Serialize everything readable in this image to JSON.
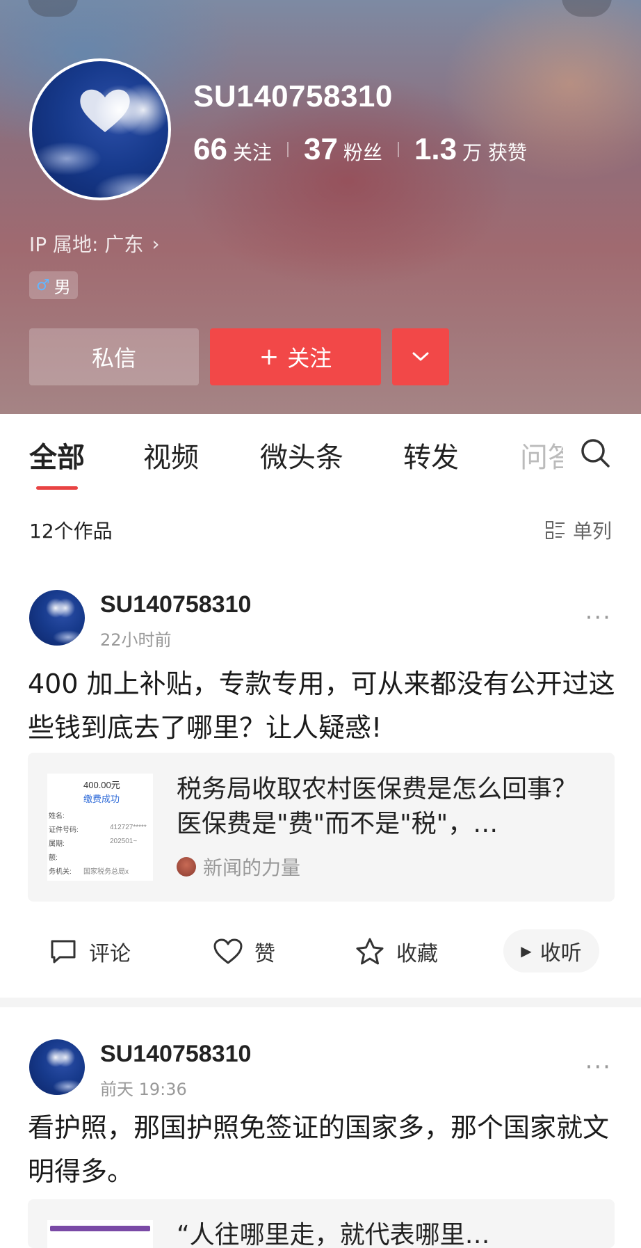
{
  "profile": {
    "username": "SU140758310",
    "following_count": "66",
    "following_label": "关注",
    "followers_count": "37",
    "followers_label": "粉丝",
    "likes_count": "1.3",
    "likes_unit_label": "万 获赞",
    "ip_location": "IP 属地: 广东",
    "gender": "男",
    "message_button": "私信",
    "follow_button": "关注"
  },
  "tabs": [
    "全部",
    "视频",
    "微头条",
    "转发",
    "问答"
  ],
  "works_count": "12个作品",
  "view_mode": "单列",
  "posts": [
    {
      "author": "SU140758310",
      "time": "22小时前",
      "text": "400 加上补贴，专款专用，可从来都没有公开过这些钱到底去了哪里？让人疑惑!",
      "card": {
        "title": "税务局收取农村医保费是怎么回事？医保费是\"费\"而不是\"税\"，…",
        "source": "新闻的力量",
        "thumb": {
          "amount": "400.00元",
          "status": "缴费成功",
          "rows": [
            {
              "label": "姓名:",
              "value": ""
            },
            {
              "label": "证件号码:",
              "value": "412727*****"
            },
            {
              "label": "属期:",
              "value": "202501~"
            },
            {
              "label": "额:",
              "value": ""
            },
            {
              "label": "务机关:",
              "value": "国家税务总局x"
            }
          ]
        }
      },
      "actions": {
        "comment": "评论",
        "like": "赞",
        "favorite": "收藏",
        "listen": "收听"
      }
    },
    {
      "author": "SU140758310",
      "time": "前天 19:36",
      "text": "看护照，那国护照免签证的国家多，那个国家就文明得多。",
      "card": {
        "title": "“人往哪里走，就代表哪里…"
      }
    }
  ],
  "colors": {
    "accent_red": "#f24848",
    "tab_underline": "#e84343"
  }
}
